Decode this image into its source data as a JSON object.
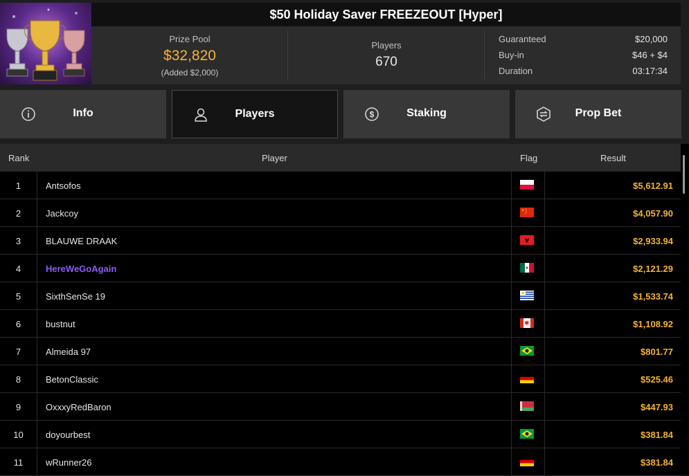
{
  "tournament": {
    "title": "$50 Holiday Saver FREEZEOUT [Hyper]",
    "prize_pool_label": "Prize Pool",
    "prize_pool_value": "$32,820",
    "prize_pool_added": "(Added $2,000)",
    "players_label": "Players",
    "players_value": "670",
    "guaranteed_label": "Guaranteed",
    "guaranteed_value": "$20,000",
    "buyin_label": "Buy-in",
    "buyin_value": "$46 + $4",
    "duration_label": "Duration",
    "duration_value": "03:17:34"
  },
  "tabs": [
    {
      "label": "Info",
      "icon": "info-icon"
    },
    {
      "label": "Players",
      "icon": "user-icon",
      "active": true
    },
    {
      "label": "Staking",
      "icon": "dollar-coin-icon"
    },
    {
      "label": "Prop Bet",
      "icon": "prop-bet-icon"
    }
  ],
  "table": {
    "headers": {
      "rank": "Rank",
      "player": "Player",
      "flag": "Flag",
      "result": "Result"
    },
    "rows": [
      {
        "rank": "1",
        "player": "Antsofos",
        "flag": "poland",
        "result": "$5,612.91"
      },
      {
        "rank": "2",
        "player": "Jackcoy",
        "flag": "china",
        "result": "$4,057.90"
      },
      {
        "rank": "3",
        "player": "BLAUWE DRAAK",
        "flag": "albania",
        "result": "$2,933.94"
      },
      {
        "rank": "4",
        "player": "HereWeGoAgain",
        "flag": "mexico",
        "result": "$2,121.29",
        "highlight": true
      },
      {
        "rank": "5",
        "player": "SixthSenSe 19",
        "flag": "uruguay",
        "result": "$1,533.74"
      },
      {
        "rank": "6",
        "player": "bustnut",
        "flag": "canada",
        "result": "$1,108.92"
      },
      {
        "rank": "7",
        "player": "Almeida 97",
        "flag": "brazil",
        "result": "$801.77"
      },
      {
        "rank": "8",
        "player": "BetonClassic",
        "flag": "germany",
        "result": "$525.46"
      },
      {
        "rank": "9",
        "player": "OxxxyRedBaron",
        "flag": "belarus",
        "result": "$447.93"
      },
      {
        "rank": "10",
        "player": "doyourbest",
        "flag": "brazil",
        "result": "$381.84"
      },
      {
        "rank": "11",
        "player": "wRunner26",
        "flag": "germany",
        "result": "$381.84"
      }
    ]
  },
  "colors": {
    "accent_gold": "#f5b335",
    "highlight_purple": "#8a5cf6"
  }
}
